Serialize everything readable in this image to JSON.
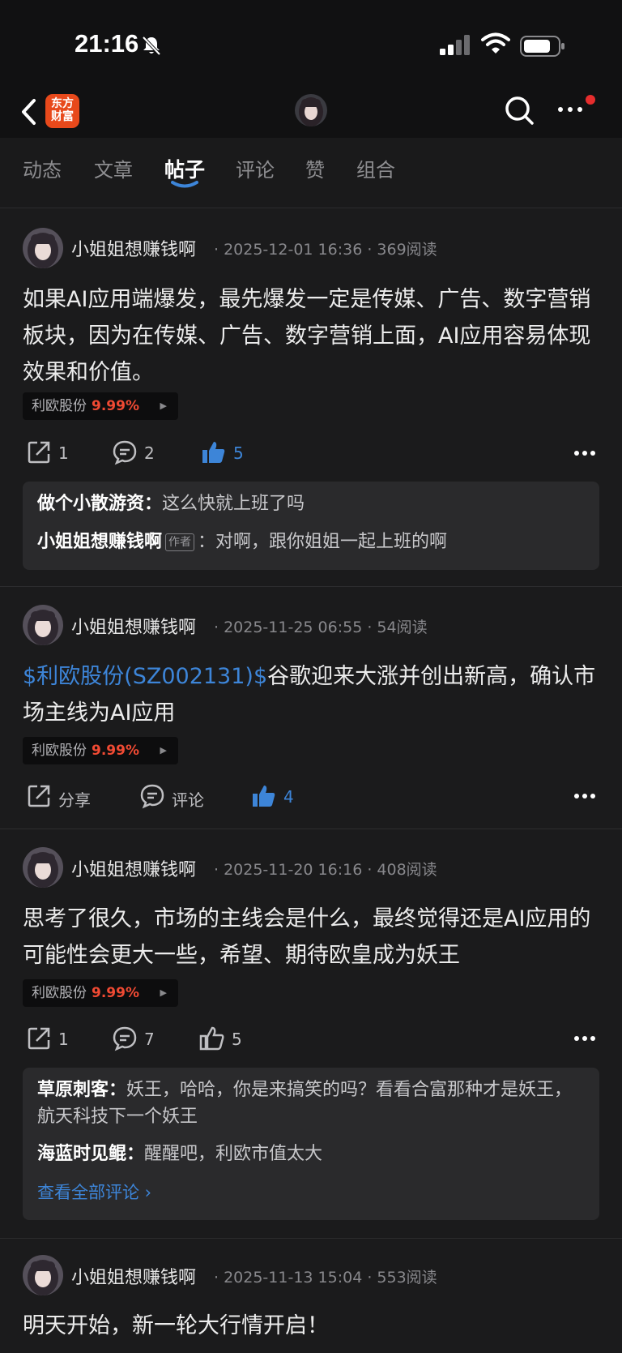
{
  "status_bar": {
    "time": "21:16"
  },
  "header": {
    "logo_text": "东方\n财富"
  },
  "tabs": [
    {
      "label": "动态"
    },
    {
      "label": "文章"
    },
    {
      "label": "帖子"
    },
    {
      "label": "评论"
    },
    {
      "label": "赞"
    },
    {
      "label": "组合"
    }
  ],
  "posts": [
    {
      "author": "小姐姐想赚钱啊",
      "meta": "· 2025-12-01 16:36 · 369阅读",
      "link": "",
      "text": "如果AI应用端爆发，最先爆发一定是传媒、广告、数字营销板块，因为在传媒、广告、数字营销上面，AI应用容易体现效果和价值。",
      "stock": {
        "name": "利欧股份",
        "pct": "9.99%"
      },
      "share": "1",
      "comment": "2",
      "like": "5",
      "comments": [
        {
          "user": "做个小散游资",
          "text": "这么快就上班了吗",
          "tag": ""
        },
        {
          "user": "小姐姐想赚钱啊",
          "text": "对啊，跟你姐姐一起上班的啊",
          "tag": "作者"
        }
      ]
    },
    {
      "author": "小姐姐想赚钱啊",
      "meta": "· 2025-11-25 06:55 · 54阅读",
      "link": "$利欧股份(SZ002131)$",
      "text": "谷歌迎来大涨并创出新高，确认市场主线为AI应用",
      "stock": {
        "name": "利欧股份",
        "pct": "9.99%"
      },
      "share": "分享",
      "comment": "评论",
      "like": "4"
    },
    {
      "author": "小姐姐想赚钱啊",
      "meta": "· 2025-11-20 16:16 · 408阅读",
      "link": "",
      "text": "思考了很久，市场的主线会是什么，最终觉得还是AI应用的可能性会更大一些，希望、期待欧皇成为妖王",
      "stock": {
        "name": "利欧股份",
        "pct": "9.99%"
      },
      "share": "1",
      "comment": "7",
      "like": "5",
      "comments": [
        {
          "user": "草原刺客",
          "text": "妖王，哈哈，你是来搞笑的吗？看看合富那种才是妖王，航天科技下一个妖王",
          "tag": ""
        },
        {
          "user": "海蓝时见鲲",
          "text": "醒醒吧，利欧市值太大",
          "tag": ""
        }
      ],
      "view_all": "查看全部评论 ›"
    },
    {
      "author": "小姐姐想赚钱啊",
      "meta": "· 2025-11-13 15:04 · 553阅读",
      "link": "",
      "text": "明天开始，新一轮大行情开启！"
    }
  ],
  "colors": {
    "accent_blue": "#3d85d8",
    "up_red": "#f04a33",
    "brand_orange": "#e8491b"
  }
}
